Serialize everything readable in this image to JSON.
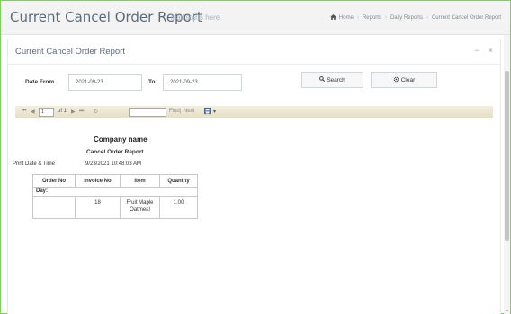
{
  "header": {
    "title": "Current Cancel Order Report",
    "subtitle": "it all starts here",
    "breadcrumb": [
      "Home",
      "Reports",
      "Daily Reports",
      "Current Cancel Order Report"
    ]
  },
  "portlet": {
    "title": "Current Cancel Order Report",
    "tools": {
      "collapse": "−",
      "close": "×"
    }
  },
  "filters": {
    "date_from_label": "Date From.",
    "date_from_value": "2021-09-23",
    "to_label": "To.",
    "to_value": "2021-09-23",
    "search_label": "Search",
    "clear_label": "Clear"
  },
  "viewer_toolbar": {
    "first": "⏮",
    "prev": "◀",
    "page_value": "1",
    "of_text": "of 1",
    "next": "▶",
    "last": "⏭",
    "refresh": "↻",
    "find_value": "",
    "find_text": "Find",
    "pipe": "|",
    "next_text": "Next",
    "export_icon": "export-icon",
    "export_caret": "▾"
  },
  "report": {
    "company": "Company name",
    "name": "Cancel Order  Report",
    "print_label": "Print Date & Time",
    "print_value": "9/23/2021 10:48:03 AM",
    "columns": [
      "Order No",
      "Invoice No",
      "Item",
      "Quantity"
    ],
    "day_label": "Day:",
    "rows": [
      {
        "order_no": "",
        "invoice_no": "18",
        "item_line1": "Fruit Maple",
        "item_line2": "Oatmeal",
        "quantity": "1.00"
      }
    ]
  }
}
